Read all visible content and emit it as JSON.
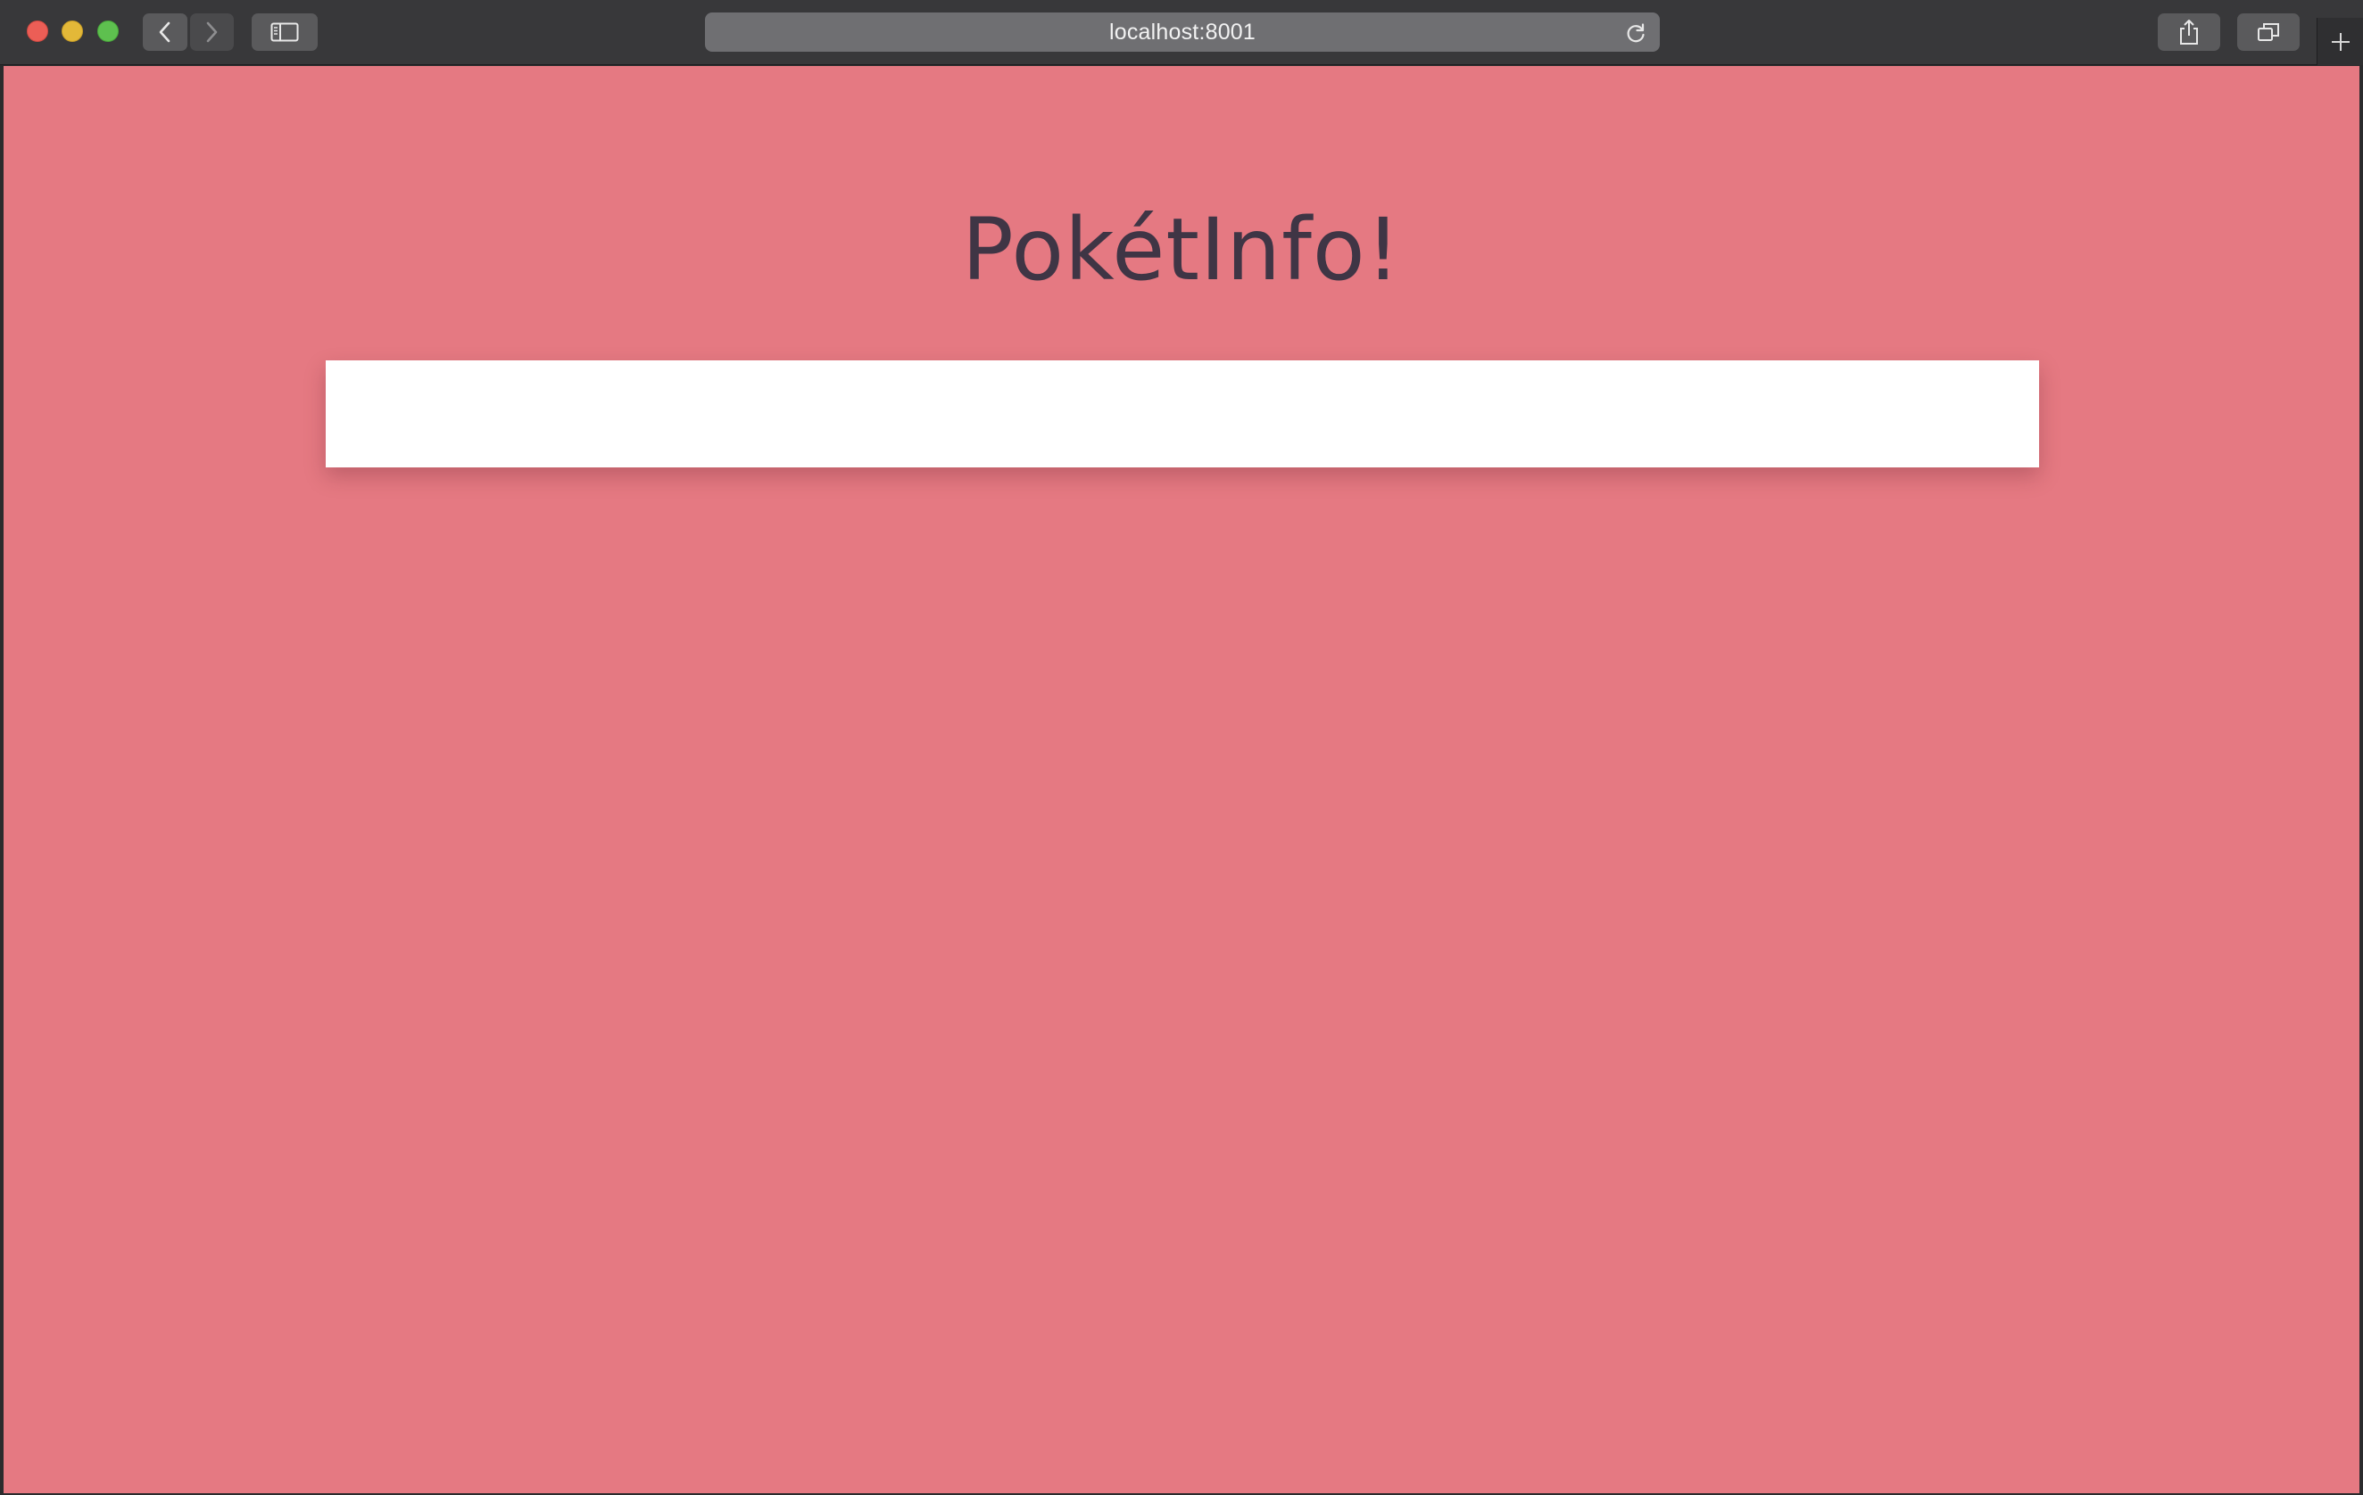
{
  "browser": {
    "url": "localhost:8001",
    "icons": {
      "close": "close-icon",
      "minimize": "minimize-icon",
      "maximize": "maximize-icon",
      "back": "chevron-left-icon",
      "forward": "chevron-right-icon",
      "sidebar": "sidebar-icon",
      "reload": "reload-icon",
      "share": "share-icon",
      "tabs": "tabs-overview-icon",
      "new_tab": "plus-icon"
    }
  },
  "page": {
    "title": "PokétInfo!",
    "search": {
      "value": "",
      "placeholder": ""
    }
  },
  "colors": {
    "background": "#e57982",
    "title": "#3f3545",
    "search_box": "#ffffff"
  }
}
